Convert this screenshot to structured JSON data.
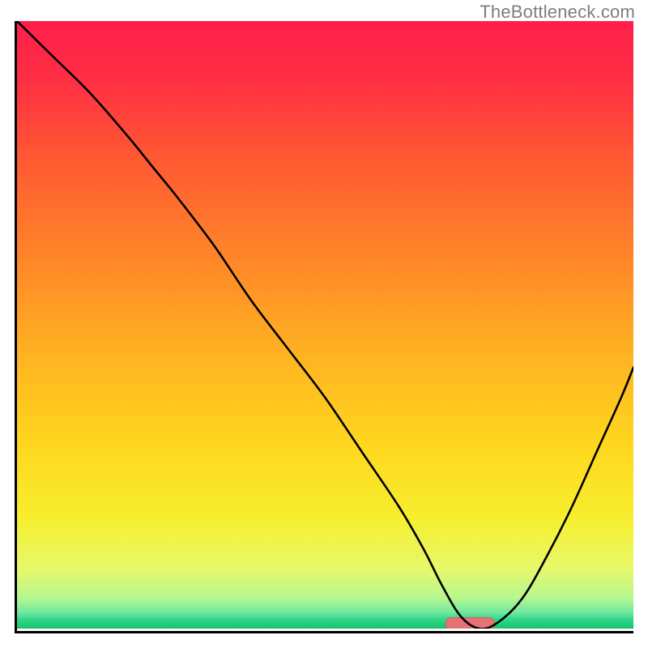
{
  "watermark": "TheBottleneck.com",
  "gradient": {
    "stops": [
      {
        "offset": 0.0,
        "color": "#ff1f4b"
      },
      {
        "offset": 0.1,
        "color": "#ff2f43"
      },
      {
        "offset": 0.22,
        "color": "#ff5733"
      },
      {
        "offset": 0.38,
        "color": "#ff8329"
      },
      {
        "offset": 0.55,
        "color": "#ffb321"
      },
      {
        "offset": 0.7,
        "color": "#ffd71f"
      },
      {
        "offset": 0.82,
        "color": "#f6ef2e"
      },
      {
        "offset": 0.9,
        "color": "#e8f86a"
      },
      {
        "offset": 0.95,
        "color": "#b6f78f"
      },
      {
        "offset": 0.974,
        "color": "#6fe7a0"
      },
      {
        "offset": 0.985,
        "color": "#30d888"
      },
      {
        "offset": 1.0,
        "color": "#17c26f"
      }
    ]
  },
  "marker": {
    "x_frac": 0.735,
    "y_frac": 0.992,
    "width_frac": 0.08,
    "color": "#e57373",
    "stroke": "#d55b5b"
  },
  "chart_data": {
    "type": "line",
    "title": "",
    "xlabel": "",
    "ylabel": "",
    "xlim": [
      0,
      100
    ],
    "ylim": [
      0,
      100
    ],
    "grid": false,
    "legend": false,
    "description": "Bottleneck-style V-curve on a red-to-green vertical gradient background. Minimum of the curve lies over the pink marker near x≈73.",
    "series": [
      {
        "name": "curve",
        "x": [
          0,
          6,
          12,
          18,
          22,
          26,
          32,
          38,
          44,
          50,
          56,
          62,
          66,
          69,
          72,
          75,
          78,
          82,
          86,
          90,
          94,
          98,
          100
        ],
        "y": [
          100,
          94,
          88,
          81,
          76,
          71,
          63,
          54,
          46,
          38,
          29,
          20,
          13,
          7,
          2,
          0,
          1,
          5,
          12,
          20,
          29,
          38,
          43
        ]
      }
    ],
    "optimal_marker_x": 73
  }
}
